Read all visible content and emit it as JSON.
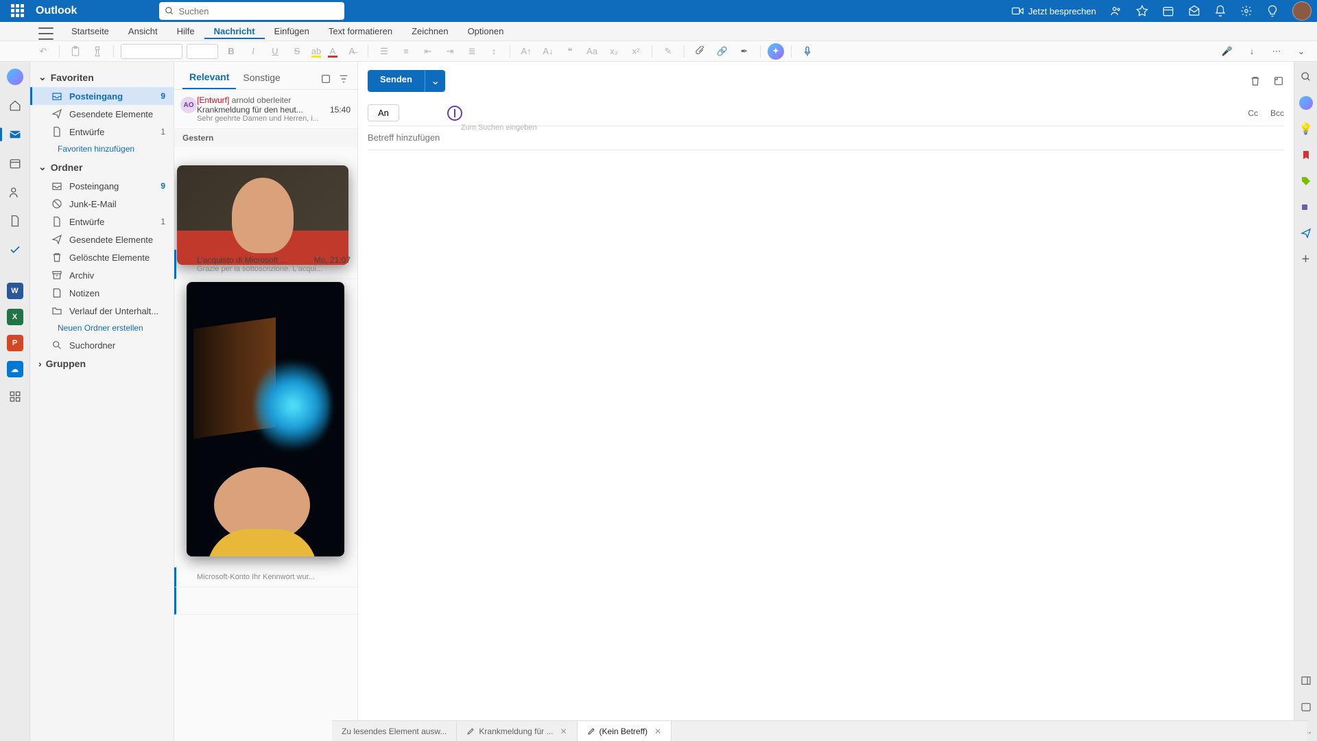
{
  "titlebar": {
    "app": "Outlook",
    "search_placeholder": "Suchen",
    "meet_label": "Jetzt besprechen"
  },
  "ribbon": {
    "tabs": [
      "Startseite",
      "Ansicht",
      "Hilfe",
      "Nachricht",
      "Einfügen",
      "Text formatieren",
      "Zeichnen",
      "Optionen"
    ],
    "active_index": 3
  },
  "nav": {
    "section_fav": "Favoriten",
    "section_ord": "Ordner",
    "section_grp": "Gruppen",
    "add_fav": "Favoriten hinzufügen",
    "new_folder": "Neuen Ordner erstellen",
    "fav_items": [
      {
        "icon": "inbox",
        "label": "Posteingang",
        "count": "9",
        "sel": true
      },
      {
        "icon": "sent",
        "label": "Gesendete Elemente"
      },
      {
        "icon": "draft",
        "label": "Entwürfe",
        "count_gray": "1"
      }
    ],
    "ord_items": [
      {
        "icon": "inbox",
        "label": "Posteingang",
        "count": "9"
      },
      {
        "icon": "junk",
        "label": "Junk-E-Mail"
      },
      {
        "icon": "draft",
        "label": "Entwürfe",
        "count_gray": "1"
      },
      {
        "icon": "sent",
        "label": "Gesendete Elemente"
      },
      {
        "icon": "trash",
        "label": "Gelöschte Elemente"
      },
      {
        "icon": "archive",
        "label": "Archiv"
      },
      {
        "icon": "notes",
        "label": "Notizen"
      },
      {
        "icon": "folder",
        "label": "Verlauf der Unterhalt..."
      },
      {
        "icon": "search",
        "label": "Suchordner"
      }
    ]
  },
  "msglist": {
    "tab_focused": "Relevant",
    "tab_other": "Sonstige",
    "header_yesterday": "Gestern",
    "msg0": {
      "avatar": "AO",
      "draft_tag": "[Entwurf]",
      "from": "arnold oberleiter",
      "subject": "Krankmeldung für den heut...",
      "time": "15:40",
      "preview": "Sehr geehrte Damen und Herren, i..."
    },
    "peek_subject": "L'acquisto di Microsoft ...",
    "peek_time": "Mo, 21:07",
    "peek_preview": "Grazie per la sottoscrizione. L'acqui...",
    "peek_last": "Microsoft-Konto Ihr Kennwort wur..."
  },
  "compose": {
    "send": "Senden",
    "to": "An",
    "cc": "Cc",
    "bcc": "Bcc",
    "to_hint": "Zum Suchen eingeben",
    "subject_ph": "Betreff hinzufügen"
  },
  "bottom": {
    "t0": "Zu lesendes Element ausw...",
    "t1": "Krankmeldung für ...",
    "t2": "(Kein Betreff)"
  }
}
